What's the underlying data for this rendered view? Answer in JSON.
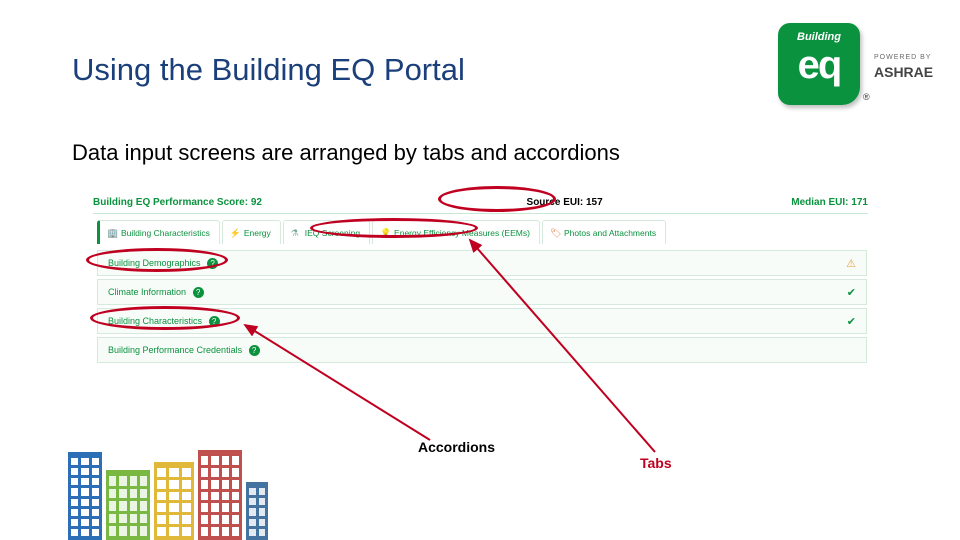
{
  "title": "Using the Building EQ Portal",
  "subtitle": "Data input screens are arranged by tabs and accordions",
  "logo": {
    "badge_top": "Building",
    "badge_main": "eq",
    "registered": "®",
    "powered": "POWERED BY",
    "brand": "ASHRAE"
  },
  "scorebar": {
    "left": "Building EQ Performance Score: 92",
    "mid": "Source EUI: 157",
    "right": "Median EUI: 171"
  },
  "tabs": [
    {
      "icon": "building-ic",
      "label": "Building Characteristics",
      "active": true
    },
    {
      "icon": "bolt-ic",
      "label": "Energy"
    },
    {
      "icon": "flask-ic",
      "label": "IEQ Screening"
    },
    {
      "icon": "bulb-ic",
      "label": "Energy Efficiency Measures (EEMs)"
    },
    {
      "icon": "tag-ic",
      "label": "Photos and Attachments"
    }
  ],
  "accordions": [
    {
      "label": "Building Demographics",
      "status": "warn",
      "glyph": "⚠"
    },
    {
      "label": "Climate Information",
      "status": "ok",
      "glyph": "✔"
    },
    {
      "label": "Building Characteristics",
      "status": "ok",
      "glyph": "✔"
    },
    {
      "label": "Building Performance Credentials",
      "status": "",
      "glyph": ""
    }
  ],
  "annotations": {
    "accordions_label": "Accordions",
    "tabs_label": "Tabs"
  }
}
